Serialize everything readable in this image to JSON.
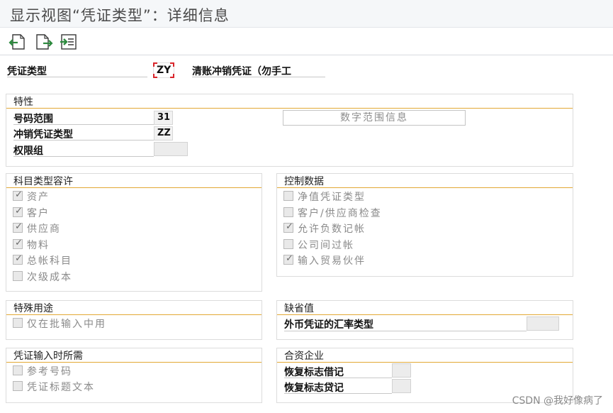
{
  "window": {
    "title": "显示视图“凭证类型”：详细信息"
  },
  "toolbar": {
    "buttons": [
      {
        "name": "back-icon"
      },
      {
        "name": "next-icon"
      },
      {
        "name": "select-icon"
      }
    ]
  },
  "header": {
    "doc_type_label": "凭证类型",
    "doc_type_value": "ZY",
    "doc_type_desc": "清账冲销凭证（勿手工"
  },
  "properties": {
    "title": "特性",
    "number_range_label": "号码范围",
    "number_range_value": "31",
    "reverse_type_label": "冲销凭证类型",
    "reverse_type_value": "ZZ",
    "auth_group_label": "权限组",
    "auth_group_value": "",
    "number_range_info_button": "数字范围信息"
  },
  "account_types": {
    "title": "科目类型容许",
    "items": [
      {
        "label": "资产",
        "checked": true
      },
      {
        "label": "客户",
        "checked": true
      },
      {
        "label": "供应商",
        "checked": true
      },
      {
        "label": "物料",
        "checked": true
      },
      {
        "label": "总帐科目",
        "checked": true
      },
      {
        "label": "次级成本",
        "checked": false
      }
    ]
  },
  "control_data": {
    "title": "控制数据",
    "items": [
      {
        "label": "净值凭证类型",
        "checked": false
      },
      {
        "label": "客户/供应商检查",
        "checked": false
      },
      {
        "label": "允许负数记帐",
        "checked": true
      },
      {
        "label": "公司间过帐",
        "checked": false
      },
      {
        "label": "输入贸易伙伴",
        "checked": true
      }
    ]
  },
  "special_usage": {
    "title": "特殊用途",
    "items": [
      {
        "label": "仅在批输入中用",
        "checked": false
      }
    ]
  },
  "defaults": {
    "title": "缺省值",
    "fx_rate_label": "外币凭证的汇率类型",
    "fx_rate_value": ""
  },
  "required_entry": {
    "title": "凭证输入时所需",
    "items": [
      {
        "label": "参考号码",
        "checked": false
      },
      {
        "label": "凭证标题文本",
        "checked": false
      }
    ]
  },
  "joint_venture": {
    "title": "合资企业",
    "debit_label": "恢复标志借记",
    "debit_value": "",
    "credit_label": "恢复标志贷记",
    "credit_value": ""
  },
  "watermark": "CSDN @我好像病了",
  "colors": {
    "accent_line": "#e2a834",
    "key_marker": "#d9252b",
    "toolbar_green": "#2d8a3e"
  }
}
